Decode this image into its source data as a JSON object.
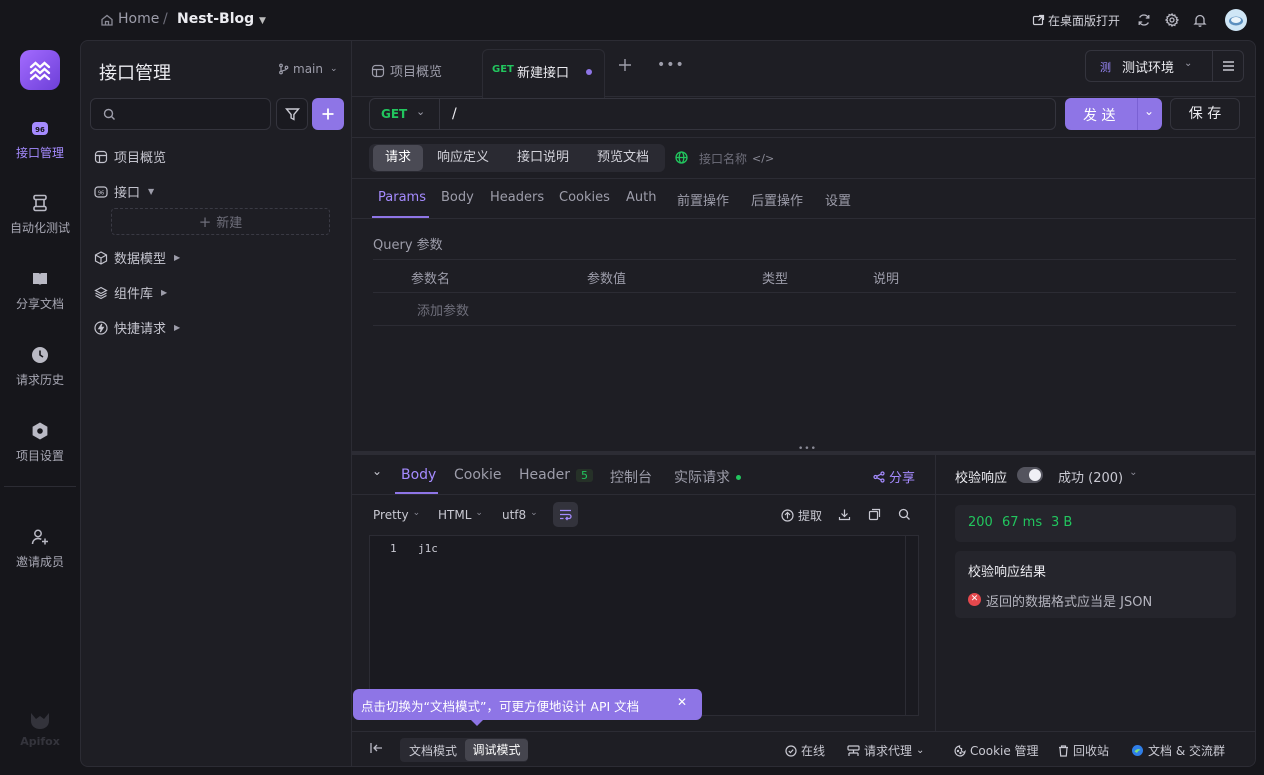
{
  "topbar": {
    "breadcrumb_home": "Home",
    "breadcrumb_sep": "/",
    "project_name": "Nest-Blog",
    "open_desktop": "在桌面版打开"
  },
  "rail": {
    "items": [
      {
        "label": "接口管理",
        "icon": "api-icon",
        "active": true
      },
      {
        "label": "自动化测试",
        "icon": "automation-icon"
      },
      {
        "label": "分享文档",
        "icon": "book-icon"
      },
      {
        "label": "请求历史",
        "icon": "clock-icon"
      },
      {
        "label": "项目设置",
        "icon": "settings-icon"
      }
    ],
    "invite": "邀请成员",
    "brand": "Apifox"
  },
  "tree": {
    "title": "接口管理",
    "branch": "main",
    "search_placeholder": "",
    "items": [
      {
        "label": "项目概览",
        "icon": "overview-icon"
      },
      {
        "label": "接口",
        "icon": "api-icon"
      },
      {
        "label": "数据模型",
        "icon": "cube-icon"
      },
      {
        "label": "组件库",
        "icon": "layers-icon"
      },
      {
        "label": "快捷请求",
        "icon": "bolt-icon"
      }
    ],
    "new_label": "新建"
  },
  "tabs": {
    "overview": "项目概览",
    "active_method": "GET",
    "active_name": "新建接口",
    "env": "测试环境",
    "env_badge": "测"
  },
  "request": {
    "method": "GET",
    "url": "/",
    "send": "发 送",
    "save": "保 存"
  },
  "modes": {
    "items": [
      "请求",
      "响应定义",
      "接口说明",
      "预览文档"
    ],
    "name_placeholder": "接口名称"
  },
  "params_tabs": [
    "Params",
    "Body",
    "Headers",
    "Cookies",
    "Auth",
    "前置操作",
    "后置操作",
    "设置"
  ],
  "query": {
    "title": "Query 参数",
    "columns": [
      "参数名",
      "参数值",
      "类型",
      "说明"
    ],
    "add_placeholder": "添加参数"
  },
  "response": {
    "tabs": [
      "Body",
      "Cookie",
      "Header",
      "控制台",
      "实际请求"
    ],
    "header_count": "5",
    "share": "分享",
    "format": "Pretty",
    "lang": "HTML",
    "encoding": "utf8",
    "extract": "提取",
    "line_no": "1",
    "content": "j1c"
  },
  "validate": {
    "label": "校验响应",
    "status_select": "成功 (200)",
    "code": "200",
    "time": "67 ms",
    "size": "3 B",
    "result_title": "校验响应结果",
    "error": "返回的数据格式应当是 JSON"
  },
  "tooltip": {
    "text": "点击切换为“文档模式”，可更方便地设计 API 文档"
  },
  "footer": {
    "doc_mode": "文档模式",
    "debug_mode": "调试模式",
    "online": "在线",
    "proxy": "请求代理",
    "cookie": "Cookie 管理",
    "recycle": "回收站",
    "community": "文档 & 交流群"
  },
  "colors": {
    "accent": "#8e75e6",
    "get": "#22c55e",
    "error": "#e5484d"
  }
}
